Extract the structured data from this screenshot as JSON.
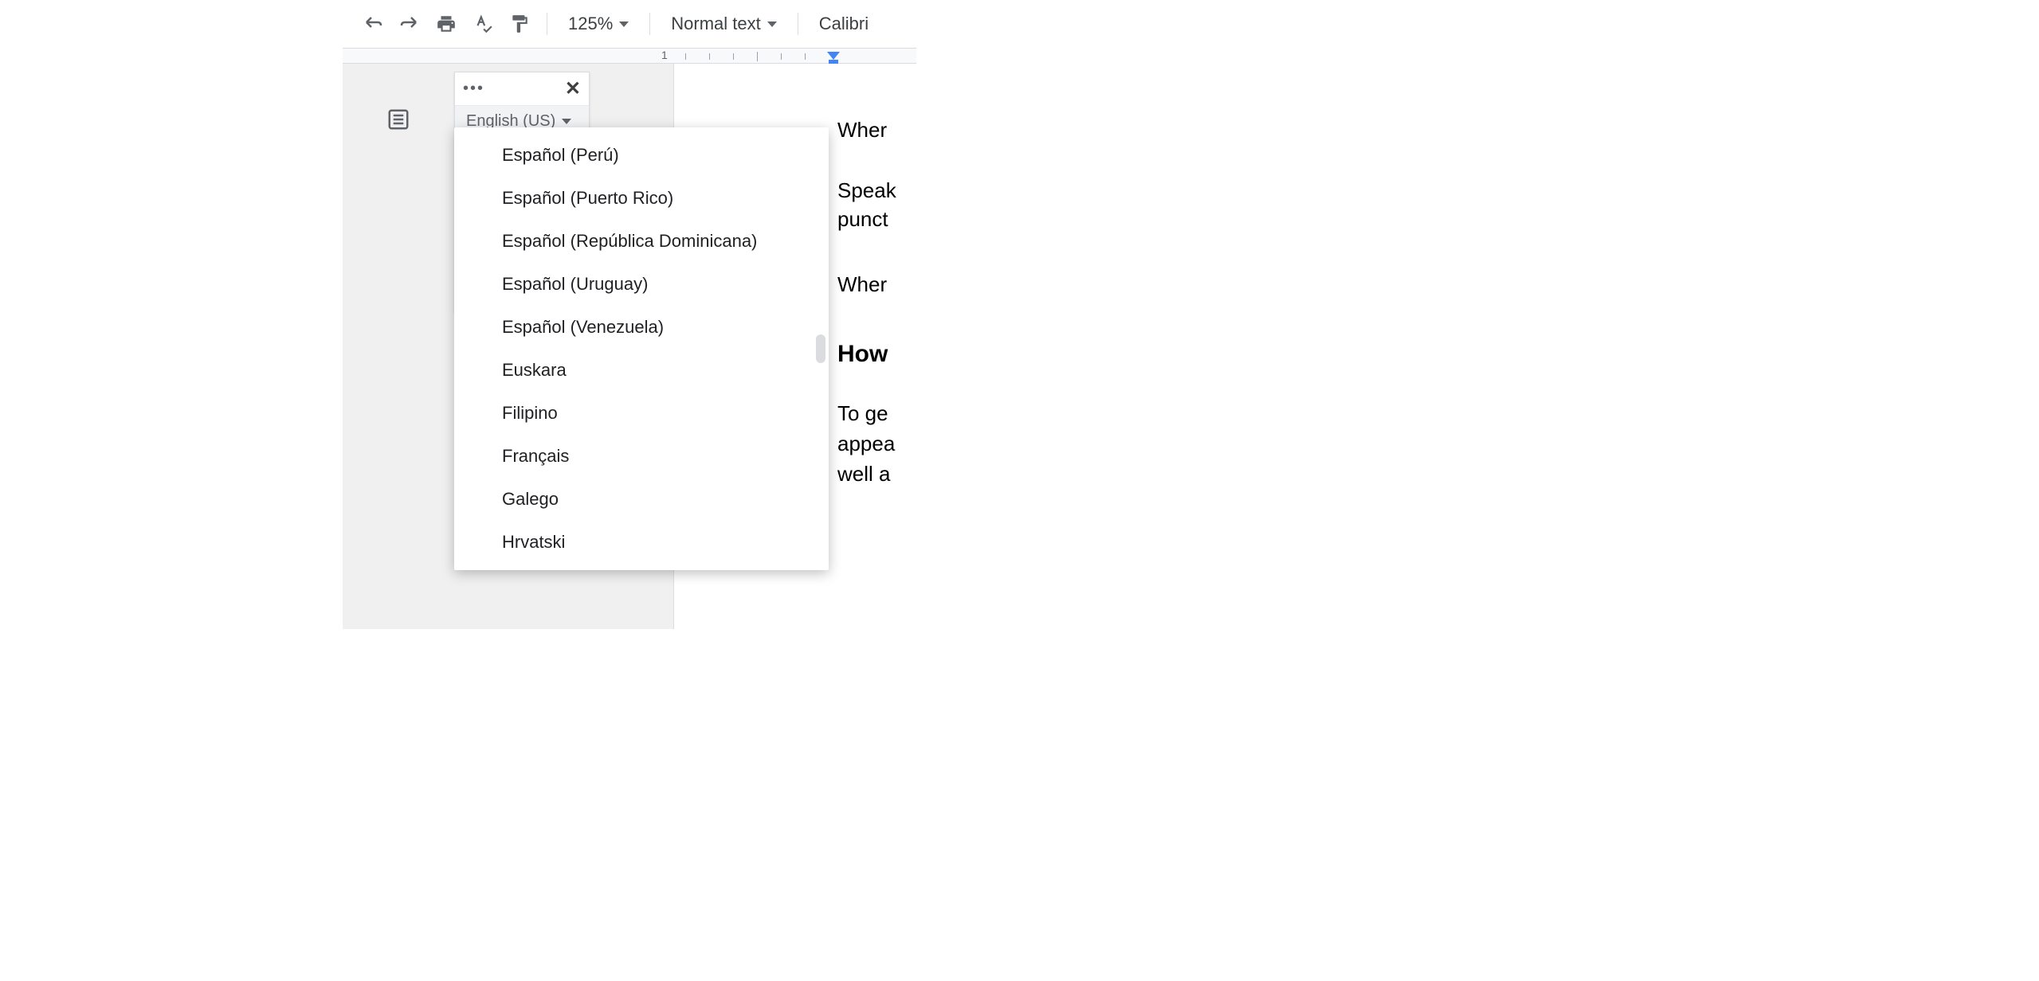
{
  "toolbar": {
    "zoom": "125%",
    "style": "Normal text",
    "font": "Calibri"
  },
  "ruler": {
    "mark": "1"
  },
  "voicePanel": {
    "selectedLanguage": "English (US)"
  },
  "languageOptions": [
    "Español (Perú)",
    "Español (Puerto Rico)",
    "Español (República Dominicana)",
    "Español (Uruguay)",
    "Español (Venezuela)",
    "Euskara",
    "Filipino",
    "Français",
    "Galego",
    "Hrvatski"
  ],
  "documentText": {
    "line1": "Wher",
    "line2": "Speak",
    "line3": "punct",
    "line4": "Wher",
    "heading": "How",
    "line5": "To ge",
    "line6": "appea",
    "line7": "well a"
  }
}
